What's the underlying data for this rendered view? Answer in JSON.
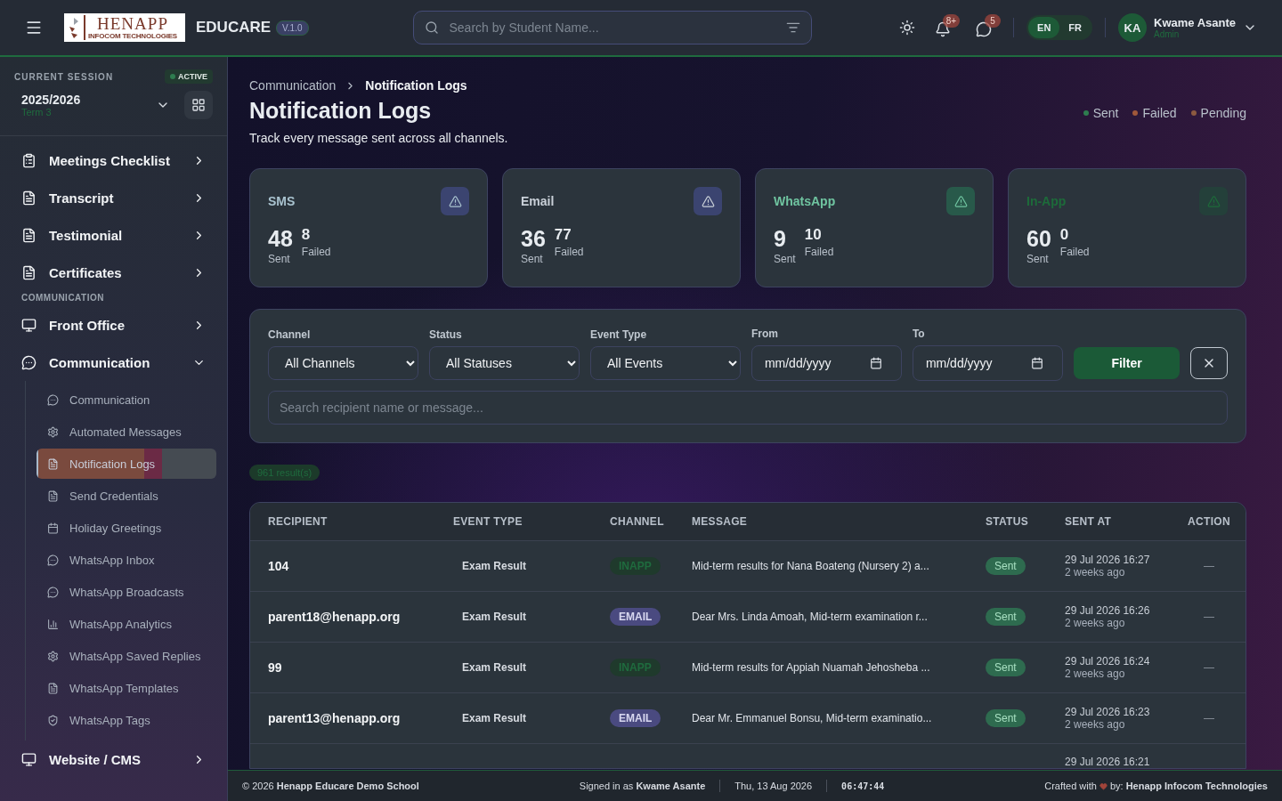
{
  "header": {
    "logo": {
      "name": "HENAPP",
      "tagline": "INFOCOM TECHNOLOGIES"
    },
    "app_name": "EDUCARE",
    "version": "V.1.0",
    "search": {
      "placeholder": "Search by Student Name..."
    },
    "notifications": {
      "count": "8+"
    },
    "messages": {
      "count": "5"
    },
    "languages": [
      {
        "label": "EN",
        "selected": true
      },
      {
        "label": "FR",
        "selected": false
      }
    ],
    "user": {
      "initials": "KA",
      "name": "Kwame Asante",
      "role": "Admin"
    }
  },
  "sidebar": {
    "session": {
      "label": "CURRENT SESSION",
      "badge": "ACTIVE",
      "year": "2025/2026",
      "term": "Term 3"
    },
    "items": [
      {
        "kind": "item",
        "label": "Meetings Checklist",
        "expanded": false
      },
      {
        "kind": "item",
        "label": "Transcript",
        "expanded": false
      },
      {
        "kind": "item",
        "label": "Testimonial",
        "expanded": false
      },
      {
        "kind": "item",
        "label": "Certificates",
        "expanded": false
      },
      {
        "kind": "section",
        "label": "COMMUNICATION"
      },
      {
        "kind": "item",
        "label": "Front Office",
        "expanded": false
      },
      {
        "kind": "item",
        "label": "Communication",
        "expanded": true,
        "children": [
          {
            "label": "Communication",
            "selected": false
          },
          {
            "label": "Automated Messages",
            "selected": false
          },
          {
            "label": "Notification Logs",
            "selected": true
          },
          {
            "label": "Send Credentials",
            "selected": false
          },
          {
            "label": "Holiday Greetings",
            "selected": false
          },
          {
            "label": "WhatsApp Inbox",
            "selected": false
          },
          {
            "label": "WhatsApp Broadcasts",
            "selected": false
          },
          {
            "label": "WhatsApp Analytics",
            "selected": false
          },
          {
            "label": "WhatsApp Saved Replies",
            "selected": false
          },
          {
            "label": "WhatsApp Templates",
            "selected": false
          },
          {
            "label": "WhatsApp Tags",
            "selected": false
          }
        ]
      },
      {
        "kind": "item",
        "label": "Website / CMS",
        "expanded": false
      }
    ]
  },
  "breadcrumb": [
    "Communication",
    "Notification Logs"
  ],
  "title": "Notification Logs",
  "subtitle": "Track every message sent across all channels.",
  "legend": [
    {
      "label": "Sent",
      "color": "#2e7d4f"
    },
    {
      "label": "Failed",
      "color": "#a0583a"
    },
    {
      "label": "Pending",
      "color": "#8c5a40"
    }
  ],
  "cards": [
    {
      "title": "SMS",
      "color": "#a9c3cf",
      "sent": "48",
      "sent_label": "Sent",
      "failed": "8",
      "failed_label": "Failed"
    },
    {
      "title": "Email",
      "color": "#c9d0d8",
      "sent": "36",
      "sent_label": "Sent",
      "failed": "77",
      "failed_label": "Failed"
    },
    {
      "title": "WhatsApp",
      "color": "#6fc4a0",
      "sent": "9",
      "sent_label": "Sent",
      "failed": "10",
      "failed_label": "Failed"
    },
    {
      "title": "In-App",
      "color": "#1d6b3a",
      "sent": "60",
      "sent_label": "Sent",
      "failed": "0",
      "failed_label": "Failed"
    }
  ],
  "filters": {
    "selects": [
      {
        "label": "Channel",
        "value": "All Channels"
      },
      {
        "label": "Status",
        "value": "All Statuses"
      },
      {
        "label": "Event Type",
        "value": "All Events"
      }
    ],
    "dates": [
      {
        "label": "From",
        "placeholder": "mm/dd/yyyy"
      },
      {
        "label": "To",
        "placeholder": "mm/dd/yyyy"
      }
    ],
    "filter_button": "Filter",
    "search": {
      "placeholder": "Search recipient name or message..."
    }
  },
  "results": "961 result(s)",
  "table": {
    "columns": [
      "RECIPIENT",
      "EVENT TYPE",
      "CHANNEL",
      "MESSAGE",
      "STATUS",
      "SENT AT",
      "ACTION"
    ],
    "rows": [
      {
        "recipient": "104",
        "event": "Exam Result",
        "channel": "INAPP",
        "color": "#1f3a2c",
        "message": "Mid-term results for Nana Boateng (Nursery 2) a...",
        "status": "Sent",
        "sent_at": "29 Jul 2026 16:27",
        "ago": "2 weeks ago",
        "action": "—"
      },
      {
        "recipient": "parent18@henapp.org",
        "event": "Exam Result",
        "channel": "EMAIL",
        "color": "#4a4a80",
        "message": "Dear Mrs. Linda Amoah, Mid-term examination r...",
        "status": "Sent",
        "sent_at": "29 Jul 2026 16:26",
        "ago": "2 weeks ago",
        "action": "—"
      },
      {
        "recipient": "99",
        "event": "Exam Result",
        "channel": "INAPP",
        "color": "#1f3a2c",
        "message": "Mid-term results for Appiah Nuamah Jehosheba ...",
        "status": "Sent",
        "sent_at": "29 Jul 2026 16:24",
        "ago": "2 weeks ago",
        "action": "—"
      },
      {
        "recipient": "parent13@henapp.org",
        "event": "Exam Result",
        "channel": "EMAIL",
        "color": "#4a4a80",
        "message": "Dear Mr. Emmanuel Bonsu, Mid-term examinatio...",
        "status": "Sent",
        "sent_at": "29 Jul 2026 16:23",
        "ago": "2 weeks ago",
        "action": "—"
      }
    ],
    "partial_row": {
      "sent_at": "29 Jul 2026 16:21"
    }
  },
  "footer": {
    "copyright": "© 2026",
    "school": "Henapp Educare Demo School",
    "signed_prefix": "Signed in as",
    "signed_user": "Kwame Asante",
    "date": "Thu, 13 Aug 2026",
    "time": "06:47:44",
    "crafted_prefix": "Crafted with",
    "crafted_by": "by:",
    "company": "Henapp Infocom Technologies"
  }
}
